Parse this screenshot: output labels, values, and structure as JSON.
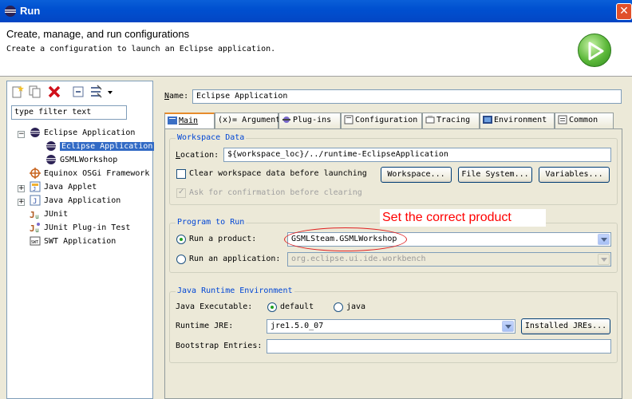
{
  "window": {
    "title": "Run",
    "close_label": "✕"
  },
  "header": {
    "title": "Create, manage, and run configurations",
    "description": "Create a configuration to launch an Eclipse application."
  },
  "left": {
    "filter_placeholder": "type filter text",
    "tree": [
      {
        "label": "Eclipse Application",
        "icon": "eclipse-icon",
        "expanded": true
      },
      {
        "label": "Eclipse Application",
        "icon": "eclipse-icon",
        "selected": true
      },
      {
        "label": "GSMLWorkshop",
        "icon": "eclipse-icon"
      },
      {
        "label": "Equinox OSGi Framework",
        "icon": "osgi-icon"
      },
      {
        "label": "Java Applet",
        "icon": "java-applet-icon"
      },
      {
        "label": "Java Application",
        "icon": "java-app-icon"
      },
      {
        "label": "JUnit",
        "icon": "junit-icon"
      },
      {
        "label": "JUnit Plug-in Test",
        "icon": "junit-plugin-icon"
      },
      {
        "label": "SWT Application",
        "icon": "swt-icon"
      }
    ]
  },
  "main": {
    "name_label": "Name:",
    "name_value": "Eclipse Application",
    "tabs": [
      {
        "label": "Main"
      },
      {
        "label": "(x)= Arguments"
      },
      {
        "label": "Plug-ins"
      },
      {
        "label": "Configuration"
      },
      {
        "label": "Tracing"
      },
      {
        "label": "Environment"
      },
      {
        "label": "Common"
      }
    ],
    "workspace": {
      "title": "Workspace Data",
      "location_label": "Location:",
      "location_value": "${workspace_loc}/../runtime-EclipseApplication",
      "clear_label": "Clear workspace data before launching",
      "btn_workspace": "Workspace...",
      "btn_filesystem": "File System...",
      "btn_variables": "Variables...",
      "ask_label": "Ask for confirmation before clearing"
    },
    "program": {
      "title": "Program to Run",
      "product_label": "Run a product:",
      "product_value": "GSMLSteam.GSMLWorkshop",
      "app_label": "Run an application:",
      "app_value": "org.eclipse.ui.ide.workbench"
    },
    "jre": {
      "title": "Java Runtime Environment",
      "exec_label": "Java Executable:",
      "default_label": "default",
      "java_label": "java",
      "runtime_label": "Runtime JRE:",
      "runtime_value": "jre1.5.0_07",
      "installed_btn": "Installed JREs...",
      "bootstrap_label": "Bootstrap Entries:",
      "bootstrap_value": ""
    }
  },
  "annotation": {
    "text": "Set the correct product"
  }
}
